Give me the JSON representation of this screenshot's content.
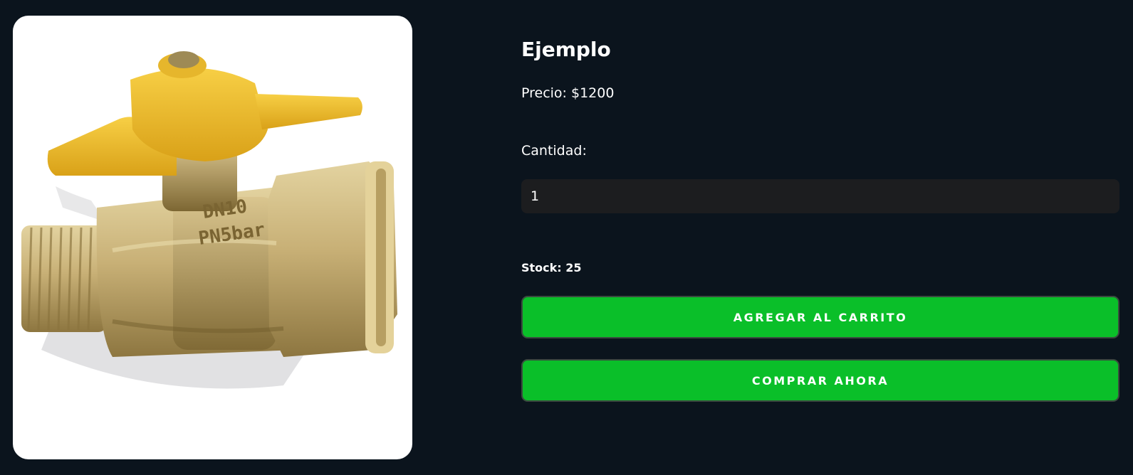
{
  "product": {
    "image_alt": "Llave de paso de bronce con manija amarilla",
    "image_markings": [
      "DN10",
      "PN5bar"
    ],
    "title": "Ejemplo",
    "price_text": "Precio: $1200",
    "quantity_label": "Cantidad:",
    "quantity_value": "1",
    "stock_text": "Stock: 25"
  },
  "actions": {
    "add_to_cart_label": "AGREGAR AL CARRITO",
    "buy_now_label": "COMPRAR AHORA"
  },
  "colors": {
    "background": "#0b141d",
    "button_green": "#0abf29",
    "input_bg": "#1c1d1f",
    "valve_yellow": "#f2c12e",
    "valve_brass": "#c9b27a"
  }
}
